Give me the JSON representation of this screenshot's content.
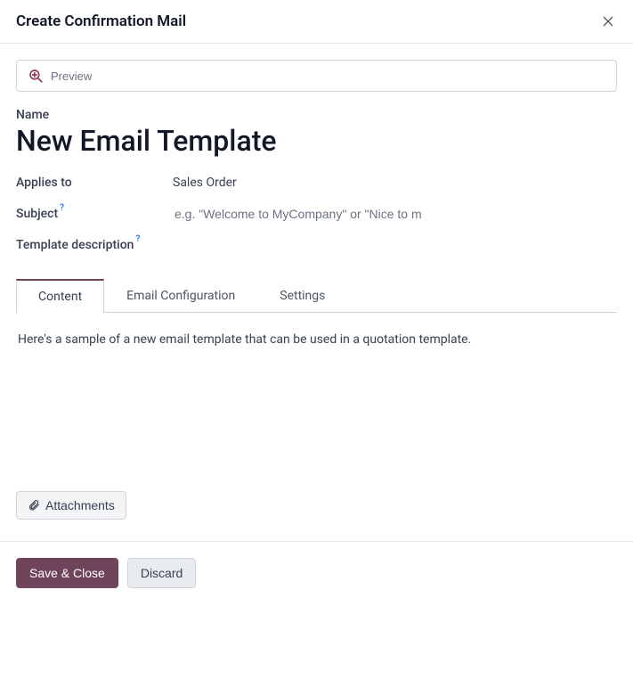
{
  "dialog": {
    "title": "Create Confirmation Mail",
    "close_label": "Close"
  },
  "preview": {
    "label": "Preview"
  },
  "fields": {
    "name_label": "Name",
    "name_value": "New Email Template",
    "applies_to_label": "Applies to",
    "applies_to_value": "Sales Order",
    "subject_label": "Subject",
    "subject_placeholder": "e.g. \"Welcome to MyCompany\" or \"Nice to m",
    "subject_value": "",
    "description_label": "Template description",
    "description_value": ""
  },
  "help_symbol": "?",
  "tabs": {
    "content": "Content",
    "email_config": "Email Configuration",
    "settings": "Settings"
  },
  "content_body": "Here's a sample of a new email template that can be used in a quotation template.",
  "attachments": {
    "label": "Attachments"
  },
  "footer": {
    "save": "Save & Close",
    "discard": "Discard"
  }
}
